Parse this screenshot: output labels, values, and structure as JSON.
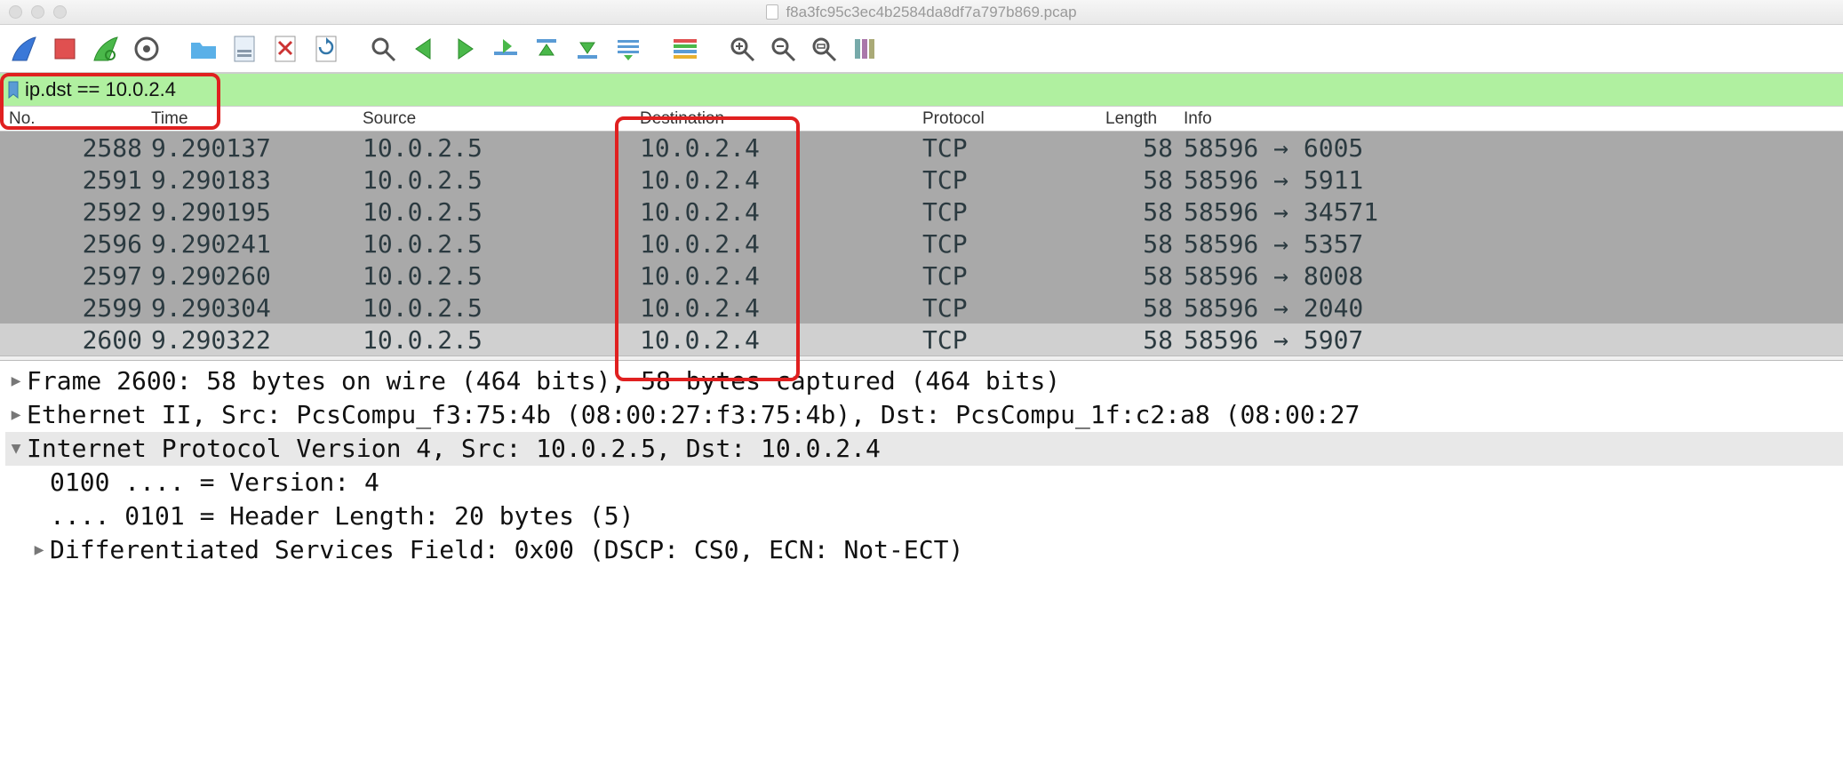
{
  "window": {
    "filename": "f8a3fc95c3ec4b2584da8df7a797b869.pcap"
  },
  "toolbar_icons": [
    "shark-fin-icon",
    "stop-icon",
    "restart-icon",
    "options-icon",
    "open-icon",
    "save-icon",
    "close-file-icon",
    "reload-icon",
    "find-icon",
    "prev-icon",
    "next-icon",
    "goto-icon",
    "first-icon",
    "last-icon",
    "autoscroll-icon",
    "colorize-icon",
    "zoom-in-icon",
    "zoom-out-icon",
    "zoom-reset-icon",
    "resize-cols-icon"
  ],
  "filter": {
    "value": "ip.dst == 10.0.2.4"
  },
  "headers": {
    "no": "No.",
    "time": "Time",
    "source": "Source",
    "destination": "Destination",
    "protocol": "Protocol",
    "length": "Length",
    "info": "Info"
  },
  "rows": [
    {
      "no": "2588",
      "time": "9.290137",
      "src": "10.0.2.5",
      "dst": "10.0.2.4",
      "proto": "TCP",
      "len": "58",
      "info": "58596 → 6005",
      "bg": "bg-gray"
    },
    {
      "no": "2591",
      "time": "9.290183",
      "src": "10.0.2.5",
      "dst": "10.0.2.4",
      "proto": "TCP",
      "len": "58",
      "info": "58596 → 5911",
      "bg": "bg-gray"
    },
    {
      "no": "2592",
      "time": "9.290195",
      "src": "10.0.2.5",
      "dst": "10.0.2.4",
      "proto": "TCP",
      "len": "58",
      "info": "58596 → 34571",
      "bg": "bg-gray"
    },
    {
      "no": "2596",
      "time": "9.290241",
      "src": "10.0.2.5",
      "dst": "10.0.2.4",
      "proto": "TCP",
      "len": "58",
      "info": "58596 → 5357",
      "bg": "bg-gray"
    },
    {
      "no": "2597",
      "time": "9.290260",
      "src": "10.0.2.5",
      "dst": "10.0.2.4",
      "proto": "TCP",
      "len": "58",
      "info": "58596 → 8008",
      "bg": "bg-gray"
    },
    {
      "no": "2599",
      "time": "9.290304",
      "src": "10.0.2.5",
      "dst": "10.0.2.4",
      "proto": "TCP",
      "len": "58",
      "info": "58596 → 2040",
      "bg": "bg-gray"
    },
    {
      "no": "2600",
      "time": "9.290322",
      "src": "10.0.2.5",
      "dst": "10.0.2.4",
      "proto": "TCP",
      "len": "58",
      "info": "58596 → 5907",
      "bg": "bg-light"
    }
  ],
  "details": {
    "line0": "Frame 2600: 58 bytes on wire (464 bits), 58 bytes captured (464 bits)",
    "line1": "Ethernet II, Src: PcsCompu_f3:75:4b (08:00:27:f3:75:4b), Dst: PcsCompu_1f:c2:a8 (08:00:27",
    "line2": "Internet Protocol Version 4, Src: 10.0.2.5, Dst: 10.0.2.4",
    "line3": "0100 .... = Version: 4",
    "line4": ".... 0101 = Header Length: 20 bytes (5)",
    "line5": "Differentiated Services Field: 0x00 (DSCP: CS0, ECN: Not-ECT)"
  }
}
